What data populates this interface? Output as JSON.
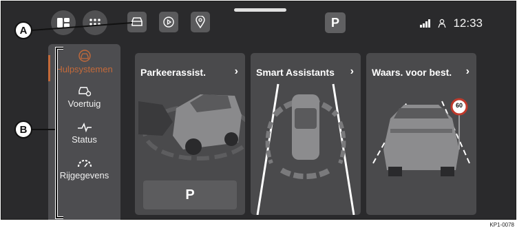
{
  "topbar": {
    "buttons": [
      {
        "icon": "screen-layout-icon"
      },
      {
        "icon": "apps-grid-icon"
      },
      {
        "icon": "car-front-icon"
      },
      {
        "icon": "play-icon"
      },
      {
        "icon": "location-pin-icon"
      }
    ],
    "parking_badge": "P",
    "time": "12:33",
    "signal_icon": "signal-bars-icon",
    "user_icon": "person-icon"
  },
  "sidebar": {
    "items": [
      {
        "label": "Hulpsystemen",
        "icon": "assistance-icon",
        "active": true
      },
      {
        "label": "Voertuig",
        "icon": "vehicle-settings-icon",
        "active": false
      },
      {
        "label": "Status",
        "icon": "pulse-icon",
        "active": false
      },
      {
        "label": "Rijgegevens",
        "icon": "gauge-icon",
        "active": false
      }
    ]
  },
  "cards": [
    {
      "title": "Parkeerassist.",
      "button_label": "P"
    },
    {
      "title": "Smart Assistants"
    },
    {
      "title": "Waars. voor best.",
      "sign_value": "60"
    }
  ],
  "callouts": {
    "a": "A",
    "b": "B"
  },
  "reference_code": "KP1-0078",
  "colors": {
    "accent": "#c46a3a",
    "background": "#2a2a2c",
    "panel": "#4a4a4c"
  }
}
